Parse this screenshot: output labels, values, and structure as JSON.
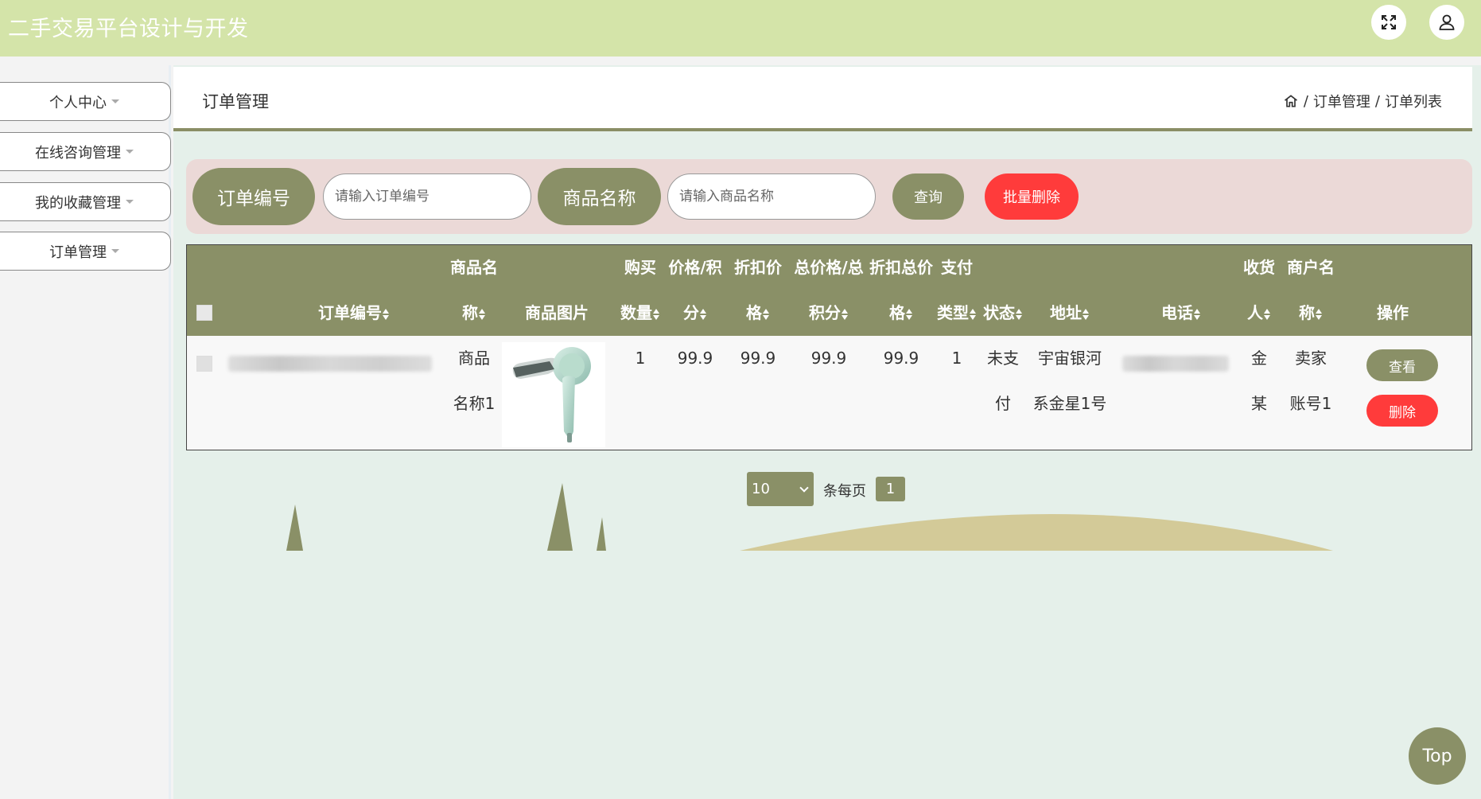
{
  "app": {
    "title": "二手交易平台设计与开发"
  },
  "topbar": {
    "fullscreen_icon": "expand-icon",
    "user_icon": "user-icon"
  },
  "sidebar": {
    "items": [
      {
        "label": "个人中心"
      },
      {
        "label": "在线咨询管理"
      },
      {
        "label": "我的收藏管理"
      },
      {
        "label": "订单管理"
      }
    ]
  },
  "header": {
    "title": "订单管理",
    "breadcrumb": {
      "home_icon": "home-icon",
      "sep": "/",
      "level1": "订单管理",
      "level2": "订单列表"
    }
  },
  "search": {
    "order_no_label": "订单编号",
    "order_no_placeholder": "请输入订单编号",
    "product_name_label": "商品名称",
    "product_name_placeholder": "请输入商品名称",
    "query_button": "查询",
    "batch_delete_button": "批量删除"
  },
  "table": {
    "headers": {
      "order_no": "订单编号",
      "product_name_1": "商品名",
      "product_name_2": "称",
      "product_image": "商品图片",
      "qty_1": "购买",
      "qty_2": "数量",
      "price_1": "价格/积",
      "price_2": "分",
      "discount_1": "折扣价",
      "discount_2": "格",
      "total_1": "总价格/总",
      "total_2": "积分",
      "disc_total_1": "折扣总价",
      "disc_total_2": "格",
      "pay_type_1": "支付",
      "pay_type_2": "类型",
      "status": "状态",
      "address": "地址",
      "phone": "电话",
      "receiver_1": "收货",
      "receiver_2": "人",
      "merchant_1": "商户名",
      "merchant_2": "称",
      "actions": "操作"
    },
    "rows": [
      {
        "product_name_1": "商品",
        "product_name_2": "名称1",
        "qty": "1",
        "price": "99.9",
        "discount_price": "99.9",
        "total": "99.9",
        "discount_total": "99.9",
        "pay_type": "1",
        "status_1": "未支",
        "status_2": "付",
        "address_1": "宇宙银河",
        "address_2": "系金星1号",
        "receiver_1": "金",
        "receiver_2": "某",
        "merchant_1": "卖家",
        "merchant_2": "账号1",
        "view_button": "查看",
        "delete_button": "删除"
      }
    ]
  },
  "pagination": {
    "page_size": "10",
    "per_page_label": "条每页",
    "current_page": "1"
  },
  "back_to_top": "Top",
  "colors": {
    "accent": "#8a9067",
    "danger": "#ff3b3b",
    "topbar": "#d4e4a9",
    "search_bg": "#ebd9d7",
    "main_bg": "#e5f0ea"
  }
}
